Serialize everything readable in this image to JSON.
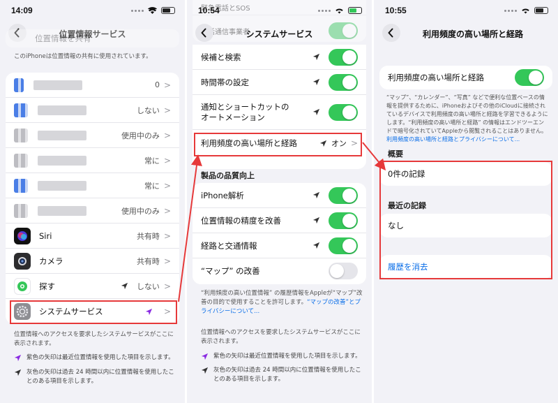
{
  "panel1": {
    "time": "14:09",
    "title": "位置情報サービス",
    "top_partial_row": "位置情報を共有",
    "sharing_note": "このiPhoneは位置情報の共有に使用されています。",
    "blurred_rows": [
      {
        "value": "0"
      },
      {
        "value": "しない"
      },
      {
        "value": "使用中のみ"
      },
      {
        "value": "常に"
      },
      {
        "value": "常に"
      },
      {
        "value": "使用中のみ"
      }
    ],
    "app_rows": [
      {
        "label": "Siri",
        "value": "共有時"
      },
      {
        "label": "カメラ",
        "value": "共有時"
      },
      {
        "label": "探す",
        "value": "しない"
      },
      {
        "label": "システムサービス",
        "value": ""
      }
    ],
    "footer": "位置情報へのアクセスを要求したシステムサービスがここに表示されます。",
    "legend_purple": "紫色の矢印は最近位置情報を使用した項目を示します。",
    "legend_gray": "灰色の矢印は過去 24 時間以内に位置情報を使用したことのある項目を示します。"
  },
  "panel2": {
    "time": "10:54",
    "partial_top_row": "緊急電話とSOS",
    "partial_second_row": "電話通信事業者",
    "title": "システムサービス",
    "rows": [
      {
        "label": "候補と検索"
      },
      {
        "label": "時間帯の設定"
      },
      {
        "label": "通知とショートカットの\nオートメーション"
      }
    ],
    "frequent_row": {
      "label": "利用頻度の高い場所と経路",
      "value": "オン"
    },
    "section_title": "製品の品質向上",
    "quality_rows": [
      {
        "label": "iPhone解析",
        "on": true
      },
      {
        "label": "位置情報の精度を改善",
        "on": true
      },
      {
        "label": "経路と交通情報",
        "on": true
      },
      {
        "label": "“マップ” の改善",
        "on": false
      }
    ],
    "note_text": "“利用頻度の高い位置情報” の履歴情報をAppleが“マップ”改善の目的で使用することを許可します。",
    "note_link": "“マップの改善”とプライバシーについて...",
    "footer": "位置情報へのアクセスを要求したシステムサービスがここに表示されます。",
    "legend_purple": "紫色の矢印は最近位置情報を使用した項目を示します。",
    "legend_gray": "灰色の矢印は過去 24 時間以内に位置情報を使用したことのある項目を示します。"
  },
  "panel3": {
    "time": "10:55",
    "title": "利用頻度の高い場所と経路",
    "toggle_label": "利用頻度の高い場所と経路",
    "description": "“マップ”、“カレンダー”、“写真” などで便利な位置ベースの情報を提供するために、iPhoneおよびその他のiCloudに接続されているデバイスで利用頻度の高い場所と経路を学習できるようにします。“利用頻度の高い場所と経路” の情報はエンドツーエンドで暗号化されていてAppleから閲覧されることはありません。",
    "description_link": "利用頻度の高い場所と経路とプライバシーについて...",
    "summary_head": "概要",
    "summary_value": "0件の記録",
    "recent_head": "最近の記録",
    "recent_value": "なし",
    "clear_history": "履歴を消去"
  },
  "colors": {
    "highlight": "#e6393a",
    "toggle_on": "#34c759",
    "link": "#0a6ee8",
    "purple_arrow": "#8a2be2"
  }
}
